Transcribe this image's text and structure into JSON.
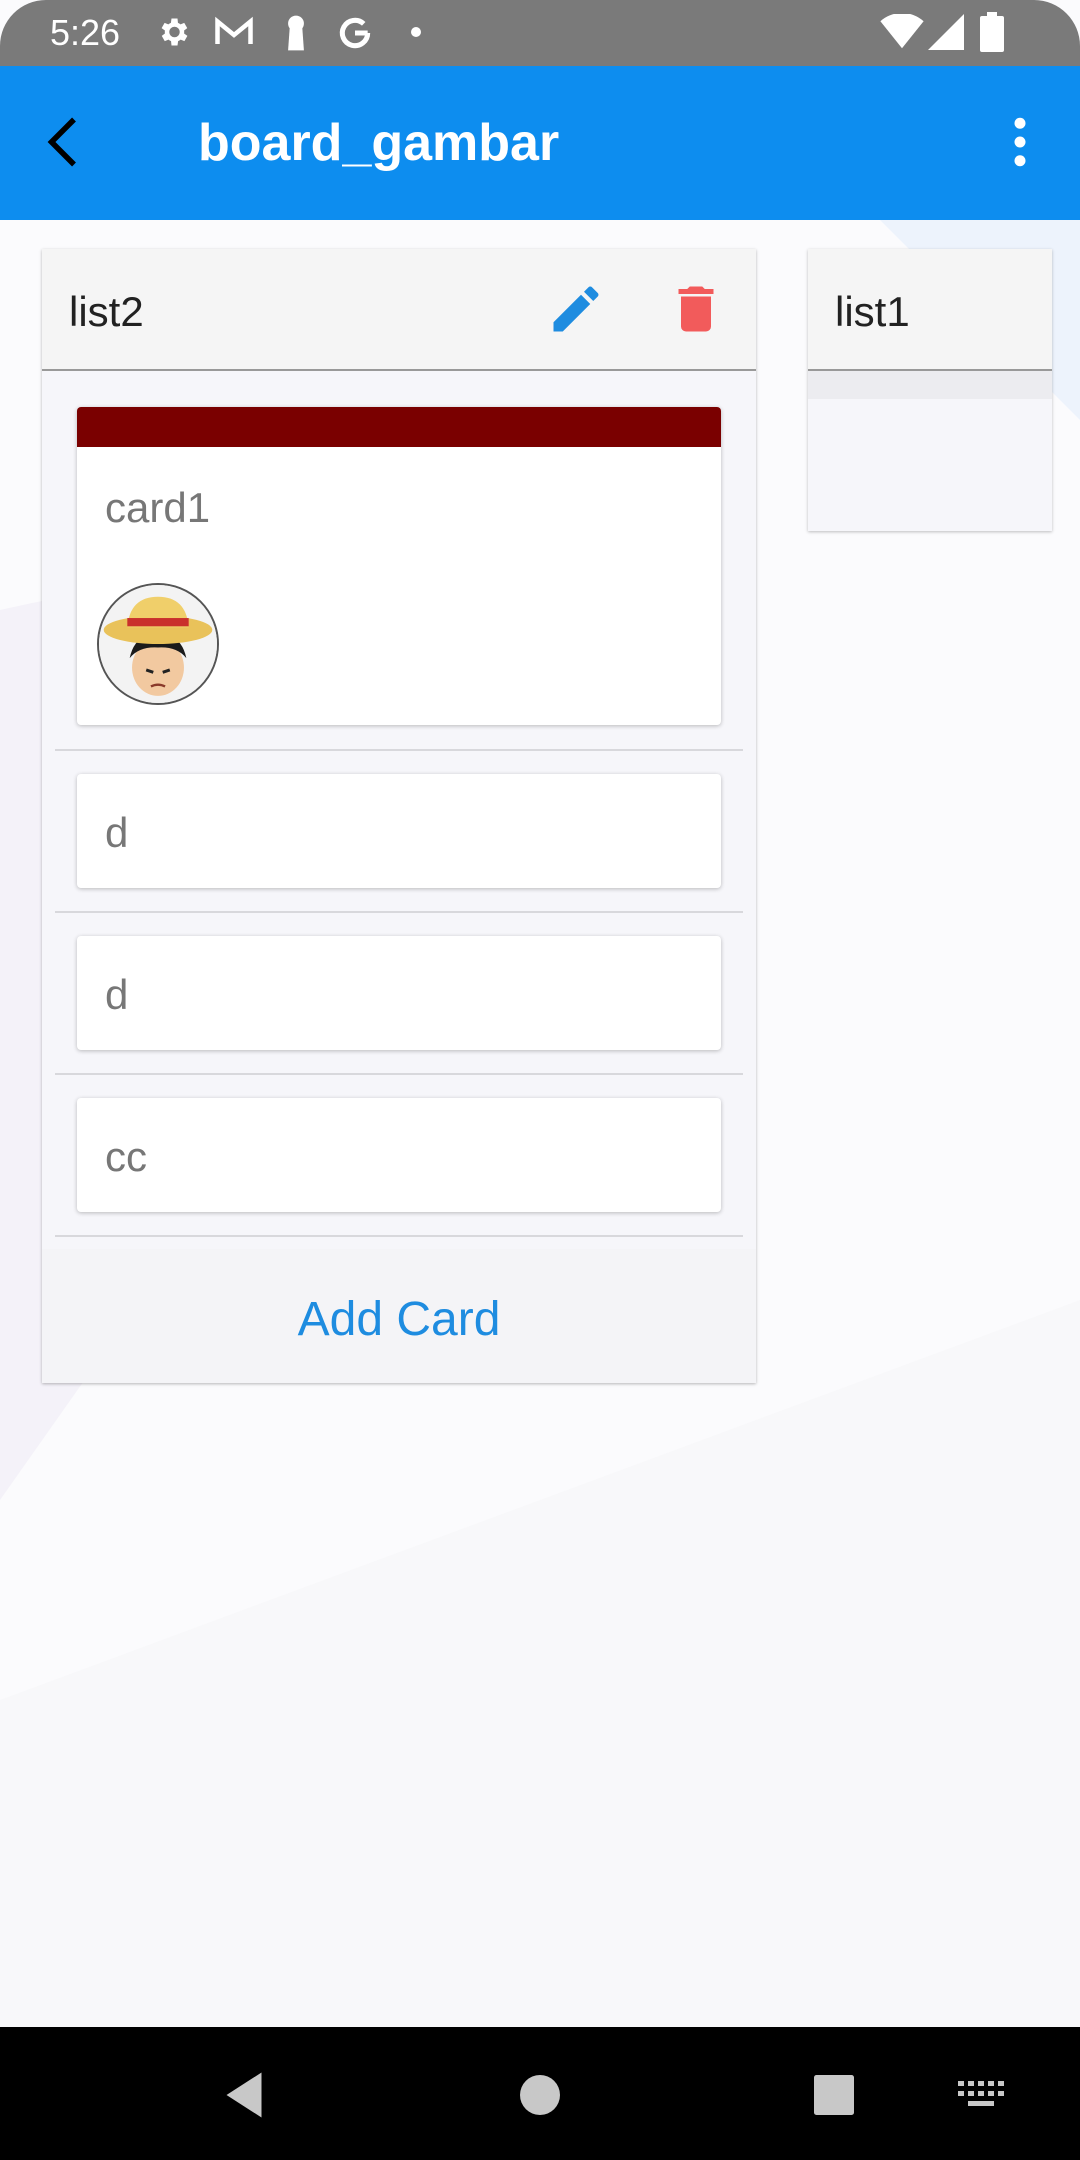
{
  "status_bar": {
    "time": "5:26",
    "left_icons": [
      "gear-icon",
      "gmail-icon",
      "keyhole-icon",
      "google-icon",
      "dot-icon"
    ],
    "right_icons": [
      "wifi-icon",
      "signal-icon",
      "battery-icon"
    ]
  },
  "app_bar": {
    "title": "board_gambar",
    "back_icon": "arrow-back-icon",
    "menu_icon": "more-vert-icon",
    "color": "#0d8def"
  },
  "lists": [
    {
      "title": "list2",
      "actions": [
        {
          "icon": "pencil-icon",
          "color": "#1e8ce0"
        },
        {
          "icon": "trash-icon",
          "color": "#f25b5b"
        }
      ],
      "cards": [
        {
          "title": "card1",
          "label_color": "#7a0000",
          "member": "avatar"
        },
        {
          "title": "d"
        },
        {
          "title": "d"
        },
        {
          "title": "cc"
        }
      ],
      "add_card_label": "Add Card"
    },
    {
      "title": "list1"
    }
  ],
  "nav_bar": {
    "buttons": [
      "back-triangle-icon",
      "home-circle-icon",
      "recents-square-icon",
      "keyboard-icon"
    ]
  }
}
